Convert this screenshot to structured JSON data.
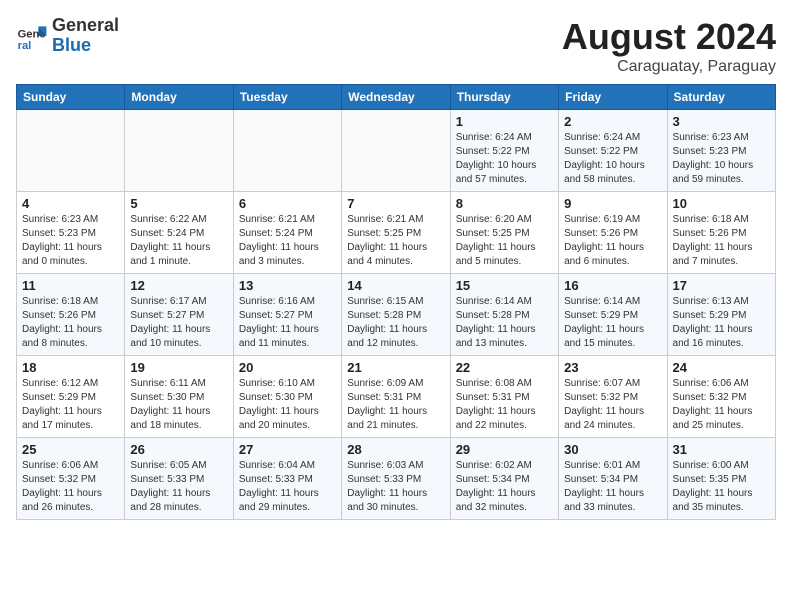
{
  "header": {
    "logo_general": "General",
    "logo_blue": "Blue",
    "title": "August 2024",
    "subtitle": "Caraguatay, Paraguay"
  },
  "weekdays": [
    "Sunday",
    "Monday",
    "Tuesday",
    "Wednesday",
    "Thursday",
    "Friday",
    "Saturday"
  ],
  "weeks": [
    [
      {
        "day": "",
        "info": ""
      },
      {
        "day": "",
        "info": ""
      },
      {
        "day": "",
        "info": ""
      },
      {
        "day": "",
        "info": ""
      },
      {
        "day": "1",
        "info": "Sunrise: 6:24 AM\nSunset: 5:22 PM\nDaylight: 10 hours\nand 57 minutes."
      },
      {
        "day": "2",
        "info": "Sunrise: 6:24 AM\nSunset: 5:22 PM\nDaylight: 10 hours\nand 58 minutes."
      },
      {
        "day": "3",
        "info": "Sunrise: 6:23 AM\nSunset: 5:23 PM\nDaylight: 10 hours\nand 59 minutes."
      }
    ],
    [
      {
        "day": "4",
        "info": "Sunrise: 6:23 AM\nSunset: 5:23 PM\nDaylight: 11 hours\nand 0 minutes."
      },
      {
        "day": "5",
        "info": "Sunrise: 6:22 AM\nSunset: 5:24 PM\nDaylight: 11 hours\nand 1 minute."
      },
      {
        "day": "6",
        "info": "Sunrise: 6:21 AM\nSunset: 5:24 PM\nDaylight: 11 hours\nand 3 minutes."
      },
      {
        "day": "7",
        "info": "Sunrise: 6:21 AM\nSunset: 5:25 PM\nDaylight: 11 hours\nand 4 minutes."
      },
      {
        "day": "8",
        "info": "Sunrise: 6:20 AM\nSunset: 5:25 PM\nDaylight: 11 hours\nand 5 minutes."
      },
      {
        "day": "9",
        "info": "Sunrise: 6:19 AM\nSunset: 5:26 PM\nDaylight: 11 hours\nand 6 minutes."
      },
      {
        "day": "10",
        "info": "Sunrise: 6:18 AM\nSunset: 5:26 PM\nDaylight: 11 hours\nand 7 minutes."
      }
    ],
    [
      {
        "day": "11",
        "info": "Sunrise: 6:18 AM\nSunset: 5:26 PM\nDaylight: 11 hours\nand 8 minutes."
      },
      {
        "day": "12",
        "info": "Sunrise: 6:17 AM\nSunset: 5:27 PM\nDaylight: 11 hours\nand 10 minutes."
      },
      {
        "day": "13",
        "info": "Sunrise: 6:16 AM\nSunset: 5:27 PM\nDaylight: 11 hours\nand 11 minutes."
      },
      {
        "day": "14",
        "info": "Sunrise: 6:15 AM\nSunset: 5:28 PM\nDaylight: 11 hours\nand 12 minutes."
      },
      {
        "day": "15",
        "info": "Sunrise: 6:14 AM\nSunset: 5:28 PM\nDaylight: 11 hours\nand 13 minutes."
      },
      {
        "day": "16",
        "info": "Sunrise: 6:14 AM\nSunset: 5:29 PM\nDaylight: 11 hours\nand 15 minutes."
      },
      {
        "day": "17",
        "info": "Sunrise: 6:13 AM\nSunset: 5:29 PM\nDaylight: 11 hours\nand 16 minutes."
      }
    ],
    [
      {
        "day": "18",
        "info": "Sunrise: 6:12 AM\nSunset: 5:29 PM\nDaylight: 11 hours\nand 17 minutes."
      },
      {
        "day": "19",
        "info": "Sunrise: 6:11 AM\nSunset: 5:30 PM\nDaylight: 11 hours\nand 18 minutes."
      },
      {
        "day": "20",
        "info": "Sunrise: 6:10 AM\nSunset: 5:30 PM\nDaylight: 11 hours\nand 20 minutes."
      },
      {
        "day": "21",
        "info": "Sunrise: 6:09 AM\nSunset: 5:31 PM\nDaylight: 11 hours\nand 21 minutes."
      },
      {
        "day": "22",
        "info": "Sunrise: 6:08 AM\nSunset: 5:31 PM\nDaylight: 11 hours\nand 22 minutes."
      },
      {
        "day": "23",
        "info": "Sunrise: 6:07 AM\nSunset: 5:32 PM\nDaylight: 11 hours\nand 24 minutes."
      },
      {
        "day": "24",
        "info": "Sunrise: 6:06 AM\nSunset: 5:32 PM\nDaylight: 11 hours\nand 25 minutes."
      }
    ],
    [
      {
        "day": "25",
        "info": "Sunrise: 6:06 AM\nSunset: 5:32 PM\nDaylight: 11 hours\nand 26 minutes."
      },
      {
        "day": "26",
        "info": "Sunrise: 6:05 AM\nSunset: 5:33 PM\nDaylight: 11 hours\nand 28 minutes."
      },
      {
        "day": "27",
        "info": "Sunrise: 6:04 AM\nSunset: 5:33 PM\nDaylight: 11 hours\nand 29 minutes."
      },
      {
        "day": "28",
        "info": "Sunrise: 6:03 AM\nSunset: 5:33 PM\nDaylight: 11 hours\nand 30 minutes."
      },
      {
        "day": "29",
        "info": "Sunrise: 6:02 AM\nSunset: 5:34 PM\nDaylight: 11 hours\nand 32 minutes."
      },
      {
        "day": "30",
        "info": "Sunrise: 6:01 AM\nSunset: 5:34 PM\nDaylight: 11 hours\nand 33 minutes."
      },
      {
        "day": "31",
        "info": "Sunrise: 6:00 AM\nSunset: 5:35 PM\nDaylight: 11 hours\nand 35 minutes."
      }
    ]
  ]
}
